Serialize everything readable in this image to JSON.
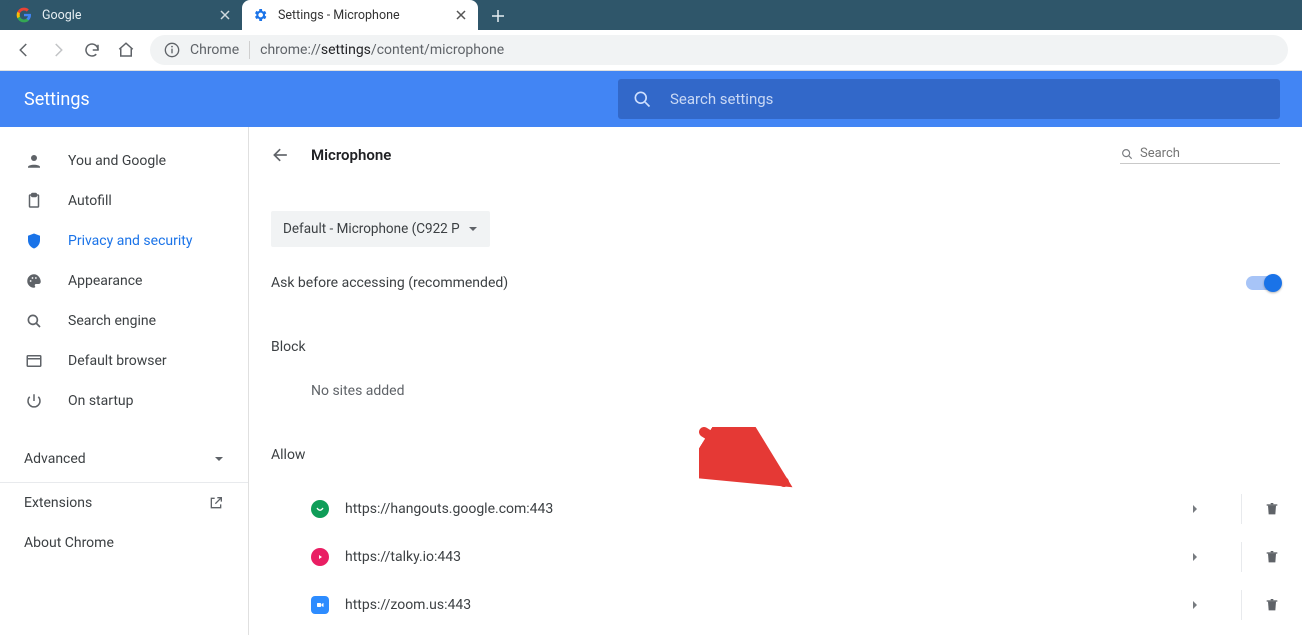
{
  "tabs": [
    {
      "title": "Google"
    },
    {
      "title": "Settings - Microphone"
    }
  ],
  "omnibox": {
    "label": "Chrome",
    "url_prefix": "chrome://",
    "url_bold": "settings",
    "url_suffix": "/content/microphone"
  },
  "appbar": {
    "title": "Settings",
    "search_placeholder": "Search settings"
  },
  "sidebar": {
    "items": [
      {
        "label": "You and Google"
      },
      {
        "label": "Autofill"
      },
      {
        "label": "Privacy and security"
      },
      {
        "label": "Appearance"
      },
      {
        "label": "Search engine"
      },
      {
        "label": "Default browser"
      },
      {
        "label": "On startup"
      }
    ],
    "advanced": "Advanced",
    "extensions": "Extensions",
    "about": "About Chrome"
  },
  "content": {
    "title": "Microphone",
    "search_placeholder": "Search",
    "device": "Default - Microphone (C922 P",
    "ask_label": "Ask before accessing (recommended)",
    "block_h": "Block",
    "block_empty": "No sites added",
    "allow_h": "Allow",
    "allow": [
      {
        "url": "https://hangouts.google.com:443",
        "color": "#0f9d58"
      },
      {
        "url": "https://talky.io:443",
        "color": "#e91e63"
      },
      {
        "url": "https://zoom.us:443",
        "color": "#2d8cff"
      }
    ]
  }
}
